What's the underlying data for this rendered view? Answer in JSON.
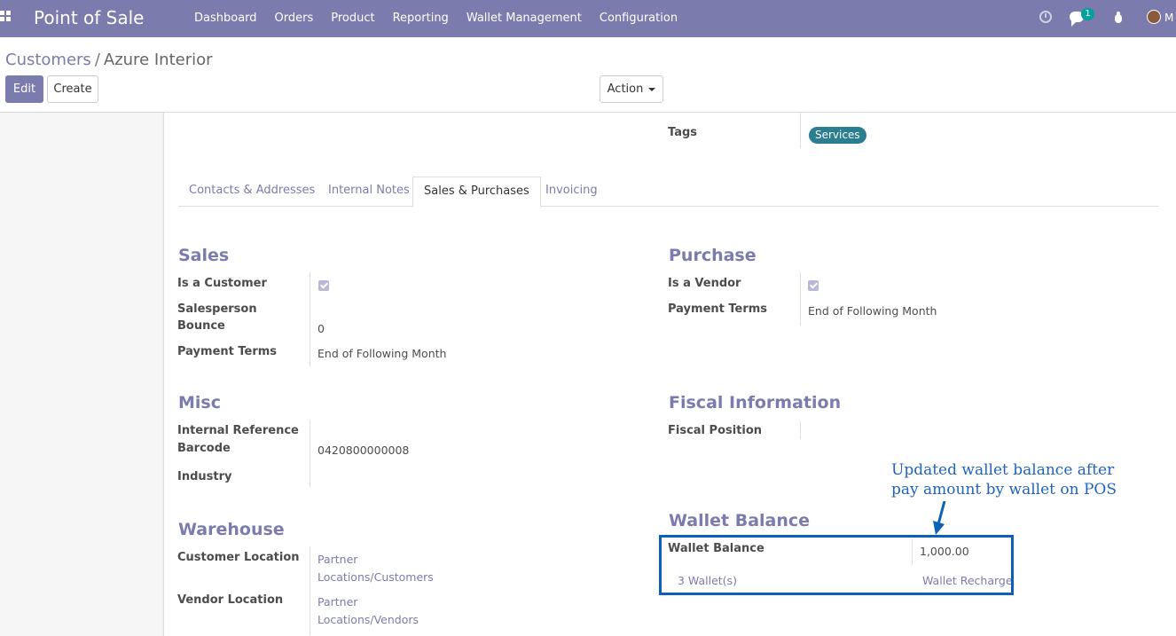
{
  "navbar": {
    "app_title": "Point of Sale",
    "menu": [
      "Dashboard",
      "Orders",
      "Product",
      "Reporting",
      "Wallet Management",
      "Configuration"
    ],
    "chat_badge": "1",
    "user_initial": "M"
  },
  "control": {
    "breadcrumb_parent": "Customers",
    "breadcrumb_sep": "/",
    "breadcrumb_current": "Azure Interior",
    "edit_label": "Edit",
    "create_label": "Create",
    "action_label": "Action"
  },
  "top": {
    "tags_label": "Tags",
    "tag_value": "Services"
  },
  "tabs": [
    "Contacts & Addresses",
    "Internal Notes",
    "Sales & Purchases",
    "Invoicing"
  ],
  "sales": {
    "title": "Sales",
    "is_customer_label": "Is a Customer",
    "salesperson_label": "Salesperson",
    "bounce_label": "Bounce",
    "bounce_value": "0",
    "payment_terms_label": "Payment Terms",
    "payment_terms_value": "End of Following Month"
  },
  "purchase": {
    "title": "Purchase",
    "is_vendor_label": "Is a Vendor",
    "payment_terms_label": "Payment Terms",
    "payment_terms_value": "End of Following Month"
  },
  "misc": {
    "title": "Misc",
    "internal_ref_label": "Internal Reference",
    "barcode_label": "Barcode",
    "barcode_value": "0420800000008",
    "industry_label": "Industry"
  },
  "fiscal": {
    "title": "Fiscal Information",
    "fiscal_position_label": "Fiscal Position"
  },
  "warehouse": {
    "title": "Warehouse",
    "customer_location_label": "Customer Location",
    "customer_location_line1": "Partner",
    "customer_location_line2": "Locations/Customers",
    "vendor_location_label": "Vendor Location",
    "vendor_location_line1": "Partner",
    "vendor_location_line2": "Locations/Vendors"
  },
  "wallet": {
    "title": "Wallet Balance",
    "balance_label": "Wallet Balance",
    "balance_value": "1,000.00",
    "wallets_link": "3 Wallet(s)",
    "recharge_link": "Wallet Recharge"
  },
  "annotation": {
    "line1": "Updated wallet balance after",
    "line2": "pay amount by wallet on POS"
  },
  "colors": {
    "brand": "#7c7bad",
    "tag": "#2a7e90",
    "annotation": "#0b61b8"
  }
}
